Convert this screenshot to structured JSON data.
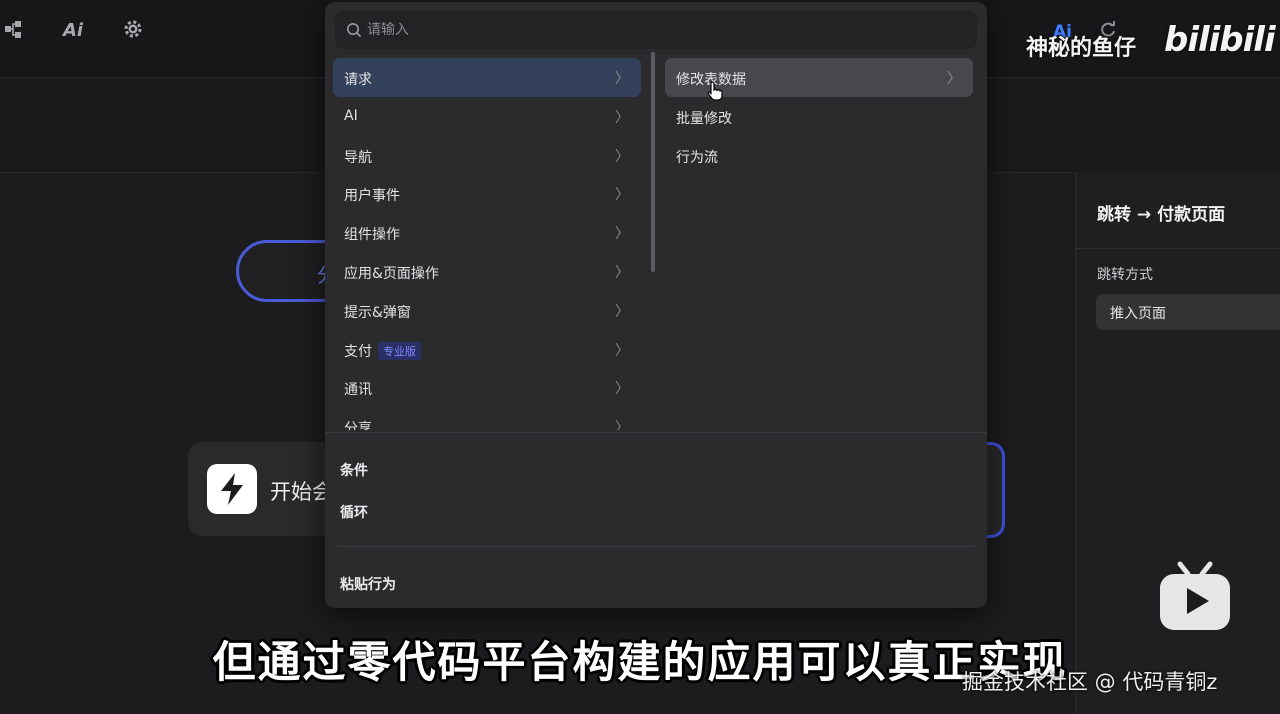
{
  "toolbar": {
    "ai_label": "Ai"
  },
  "canvas": {
    "trigger_label": "开始会",
    "pill_fragment": "分"
  },
  "right_panel": {
    "title": "跳转 → 付款页面",
    "field_label": "跳转方式",
    "field_value": "推入页面"
  },
  "popup": {
    "search_placeholder": "请输入",
    "categories": [
      {
        "label": "请求",
        "active": true
      },
      {
        "label": "AI"
      },
      {
        "label": "导航"
      },
      {
        "label": "用户事件"
      },
      {
        "label": "组件操作"
      },
      {
        "label": "应用&页面操作"
      },
      {
        "label": "提示&弹窗"
      },
      {
        "label": "支付",
        "badge": "专业版"
      },
      {
        "label": "通讯"
      },
      {
        "label": "分享"
      }
    ],
    "sub_items": [
      {
        "label": "修改表数据",
        "has_children": true
      },
      {
        "label": "批量修改"
      },
      {
        "label": "行为流"
      }
    ],
    "bottom_items": {
      "condition": "条件",
      "loop": "循环",
      "paste": "粘贴行为"
    }
  },
  "overlay": {
    "uploader": "神秘的鱼仔",
    "platform_logo": "bilibili",
    "subtitle": "但通过零代码平台构建的应用可以真正实现",
    "credit": "掘金技术社区 @ 代码青铜z"
  },
  "colors": {
    "accent": "#4b5ad8",
    "active_row": "#33415a",
    "badge_text": "#7f8cff"
  }
}
